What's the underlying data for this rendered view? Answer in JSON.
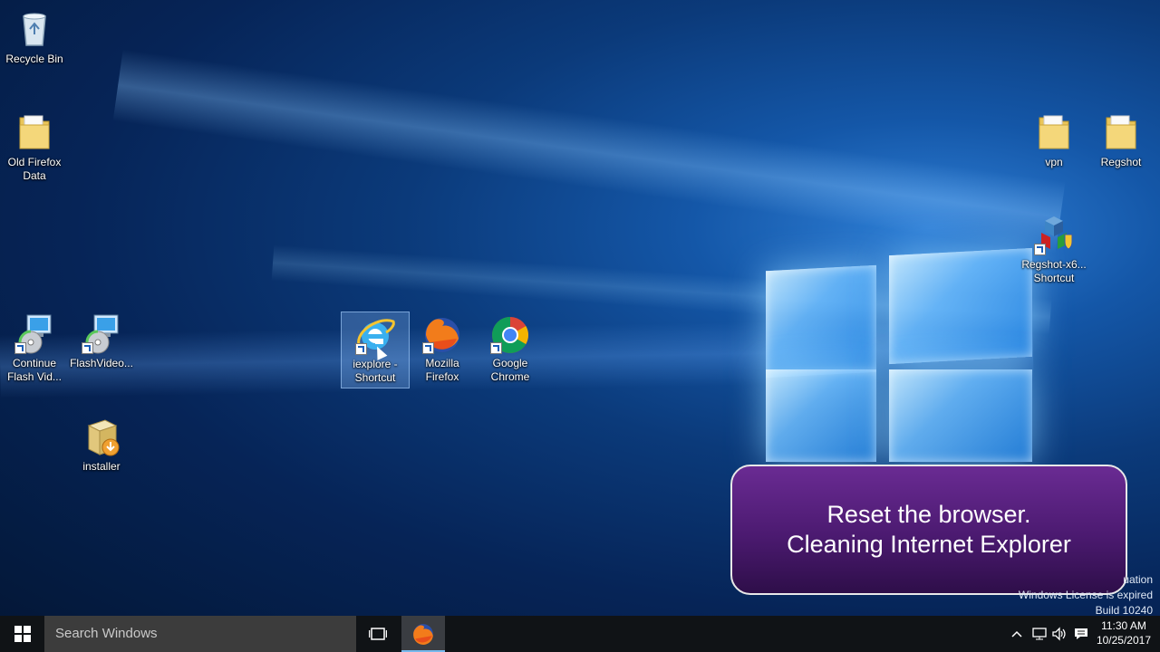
{
  "desktop": {
    "icons": [
      {
        "label": "Recycle Bin",
        "icon": "recycle-bin-icon"
      },
      {
        "label": "Old Firefox Data",
        "icon": "folder-icon"
      },
      {
        "label": "Continue Flash Vid...",
        "icon": "installer-disc-icon"
      },
      {
        "label": "FlashVideo...",
        "icon": "installer-disc-icon"
      },
      {
        "label": "installer",
        "icon": "installer-package-icon"
      },
      {
        "label": "iexplore - Shortcut",
        "icon": "internet-explorer-icon"
      },
      {
        "label": "Mozilla Firefox",
        "icon": "firefox-icon"
      },
      {
        "label": "Google Chrome",
        "icon": "chrome-icon"
      },
      {
        "label": "vpn",
        "icon": "folder-icon"
      },
      {
        "label": "Regshot",
        "icon": "folder-icon"
      },
      {
        "label": "Regshot-x6... Shortcut",
        "icon": "regshot-icon"
      }
    ]
  },
  "overlay": {
    "line1": "Reset the browser.",
    "line2": "Cleaning Internet Explorer"
  },
  "watermark": {
    "line1": "uation",
    "line2": "Windows License is expired",
    "line3": "Build 10240"
  },
  "taskbar": {
    "search_placeholder": "Search Windows",
    "time": "11:30 AM",
    "date": "10/25/2017"
  },
  "colors": {
    "overlay": "#4b1a70",
    "taskbar": "#101316",
    "accent": "#76b9ed"
  }
}
